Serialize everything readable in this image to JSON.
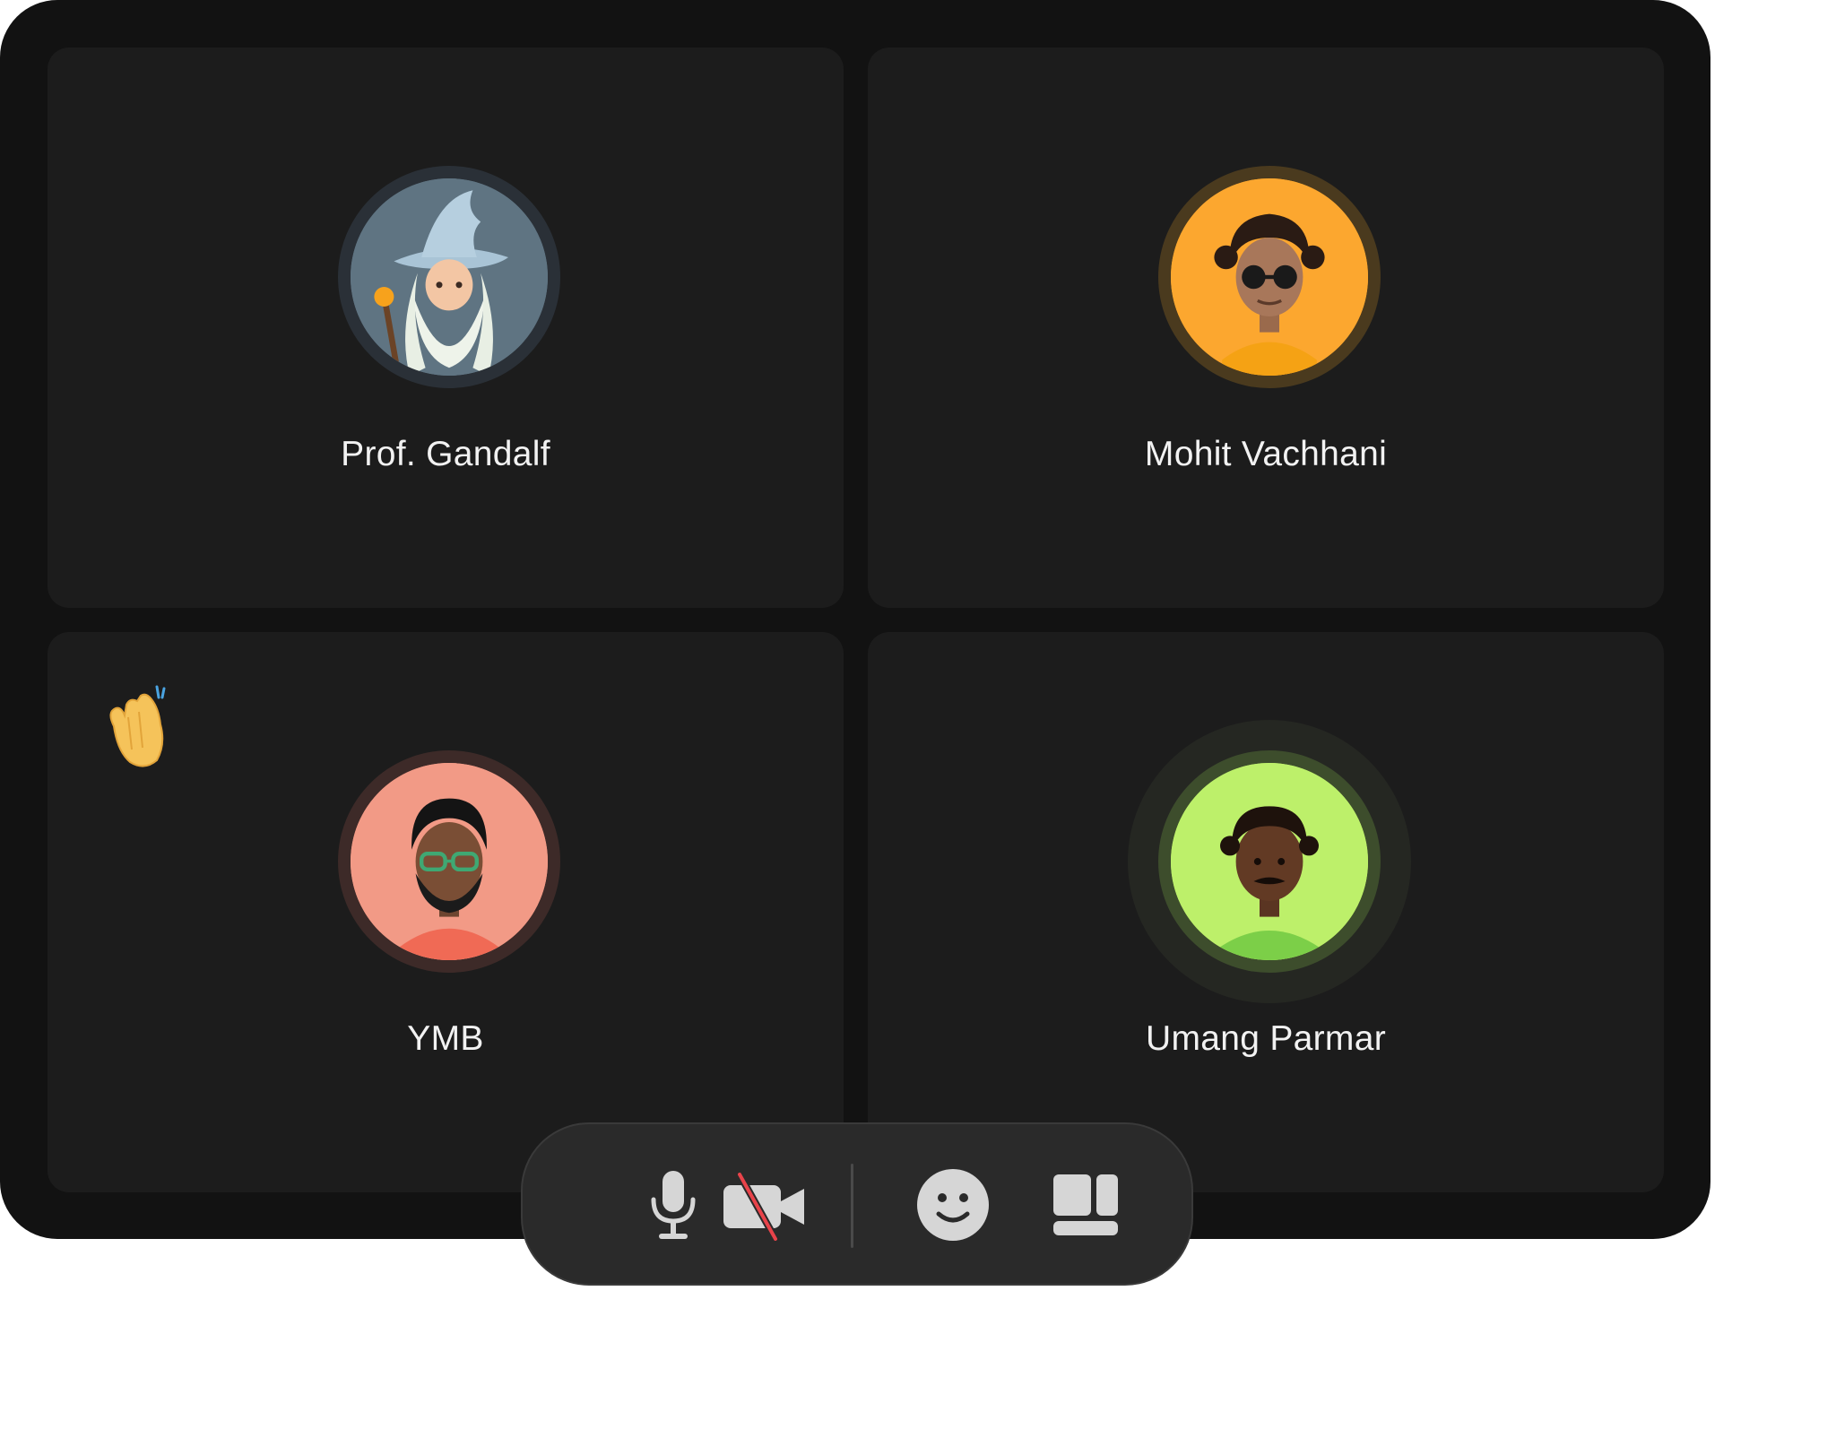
{
  "participants": [
    {
      "name": "Prof. Gandalf",
      "avatar": "wizard-avatar",
      "avatar_bg": "#5f7482",
      "ring": "#2a3037"
    },
    {
      "name": "Mohit Vachhani",
      "avatar": "person-sunglasses-avatar",
      "avatar_bg": "#fca72f",
      "ring": "#4a3a1e"
    },
    {
      "name": "YMB",
      "avatar": "person-glasses-beard-avatar",
      "avatar_bg": "#f29a86",
      "ring": "#3d2a28",
      "reaction": "clapping-hands"
    },
    {
      "name": "Umang Parmar",
      "avatar": "person-mustache-avatar",
      "avatar_bg": "#bdf06a",
      "ring": "#3d4d2c",
      "speaking": true
    }
  ],
  "toolbar": {
    "icons": [
      "microphone-icon",
      "camera-off-icon",
      "emoji-icon",
      "layout-icon"
    ],
    "camera_off_slash_color": "#e8434a",
    "icon_color": "#d6d6d6"
  }
}
